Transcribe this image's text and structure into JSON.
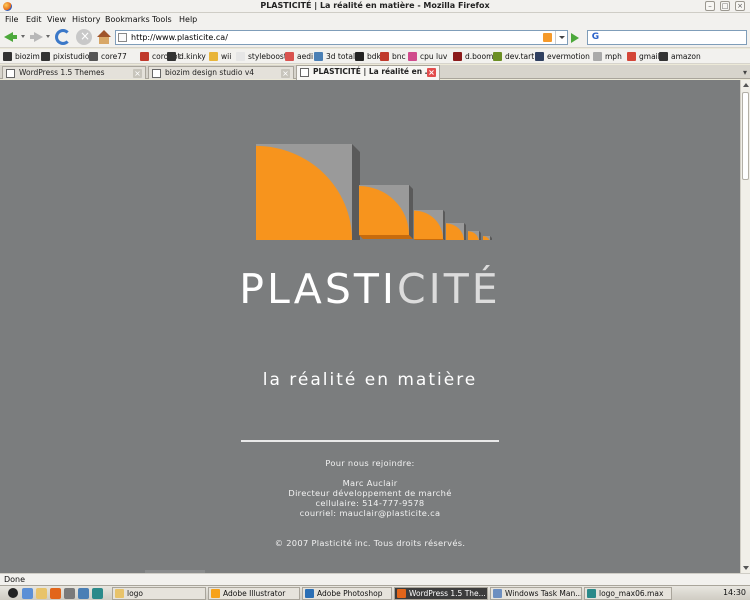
{
  "window": {
    "title": "PLASTICITÉ | La réalité en matière - Mozilla Firefox"
  },
  "menu": [
    "File",
    "Edit",
    "View",
    "History",
    "Bookmarks",
    "Tools",
    "Help"
  ],
  "nav": {
    "url": "http://www.plasticite.ca/",
    "search_engine": "G",
    "search_value": ""
  },
  "bookmarks": [
    {
      "label": "biozim",
      "color": "#333333"
    },
    {
      "label": "pixistudio",
      "color": "#333333"
    },
    {
      "label": "core77",
      "color": "#555555"
    },
    {
      "label": "coroflot",
      "color": "#c0392b"
    },
    {
      "label": "d.kinky",
      "color": "#333333"
    },
    {
      "label": "wii",
      "color": "#e8b53a"
    },
    {
      "label": "styleboost",
      "color": "#e6e6e6"
    },
    {
      "label": "aedi",
      "color": "#d9534f"
    },
    {
      "label": "3d total",
      "color": "#4a7fb5"
    },
    {
      "label": "bdk",
      "color": "#222222"
    },
    {
      "label": "bnc",
      "color": "#c0392b"
    },
    {
      "label": "cpu luv",
      "color": "#d04a8c"
    },
    {
      "label": "d.boom",
      "color": "#8b1a1a"
    },
    {
      "label": "dev.tart",
      "color": "#6b8e23"
    },
    {
      "label": "evermotion",
      "color": "#2f3f5f"
    },
    {
      "label": "mph",
      "color": "#aaaaaa"
    },
    {
      "label": "gmail",
      "color": "#d44638"
    },
    {
      "label": "amazon",
      "color": "#333333"
    }
  ],
  "tabs": [
    {
      "label": "WordPress 1.5 Themes",
      "active": false
    },
    {
      "label": "biozim design studio v4",
      "active": false
    },
    {
      "label": "PLASTICITÉ | La réalité en ...",
      "active": true
    }
  ],
  "page": {
    "brand_part1": "PLASTI",
    "brand_part2": "CITÉ",
    "tagline": "la réalité en matière",
    "contact_heading": "Pour nous rejoindre:",
    "contact_name": "Marc Auclair",
    "contact_role": "Directeur développement de marché",
    "contact_phone": "cellulaire: 514-777-9578",
    "contact_email": "courriel: mauclair@plasticite.ca",
    "copyright": "© 2007 Plasticité inc.  Tous droits réservés.",
    "logo_colors": {
      "face": "#f7941d",
      "side": "#5a5a5a",
      "top": "#9a9a9a"
    }
  },
  "status": {
    "text": "Done"
  },
  "taskbar": {
    "tasks": [
      {
        "label": "logo",
        "color": "#e8c36a",
        "active": false
      },
      {
        "label": "Adobe Illustrator",
        "color": "#f7a21b",
        "active": false
      },
      {
        "label": "Adobe Photoshop",
        "color": "#2b6fb5",
        "active": false
      },
      {
        "label": "WordPress 1.5 The...",
        "color": "#e2651a",
        "active": true
      },
      {
        "label": "Windows Task Man...",
        "color": "#6d8fc0",
        "active": false
      },
      {
        "label": "logo_max06.max",
        "color": "#2a8a8a",
        "active": false
      }
    ],
    "clock": "14:30"
  }
}
